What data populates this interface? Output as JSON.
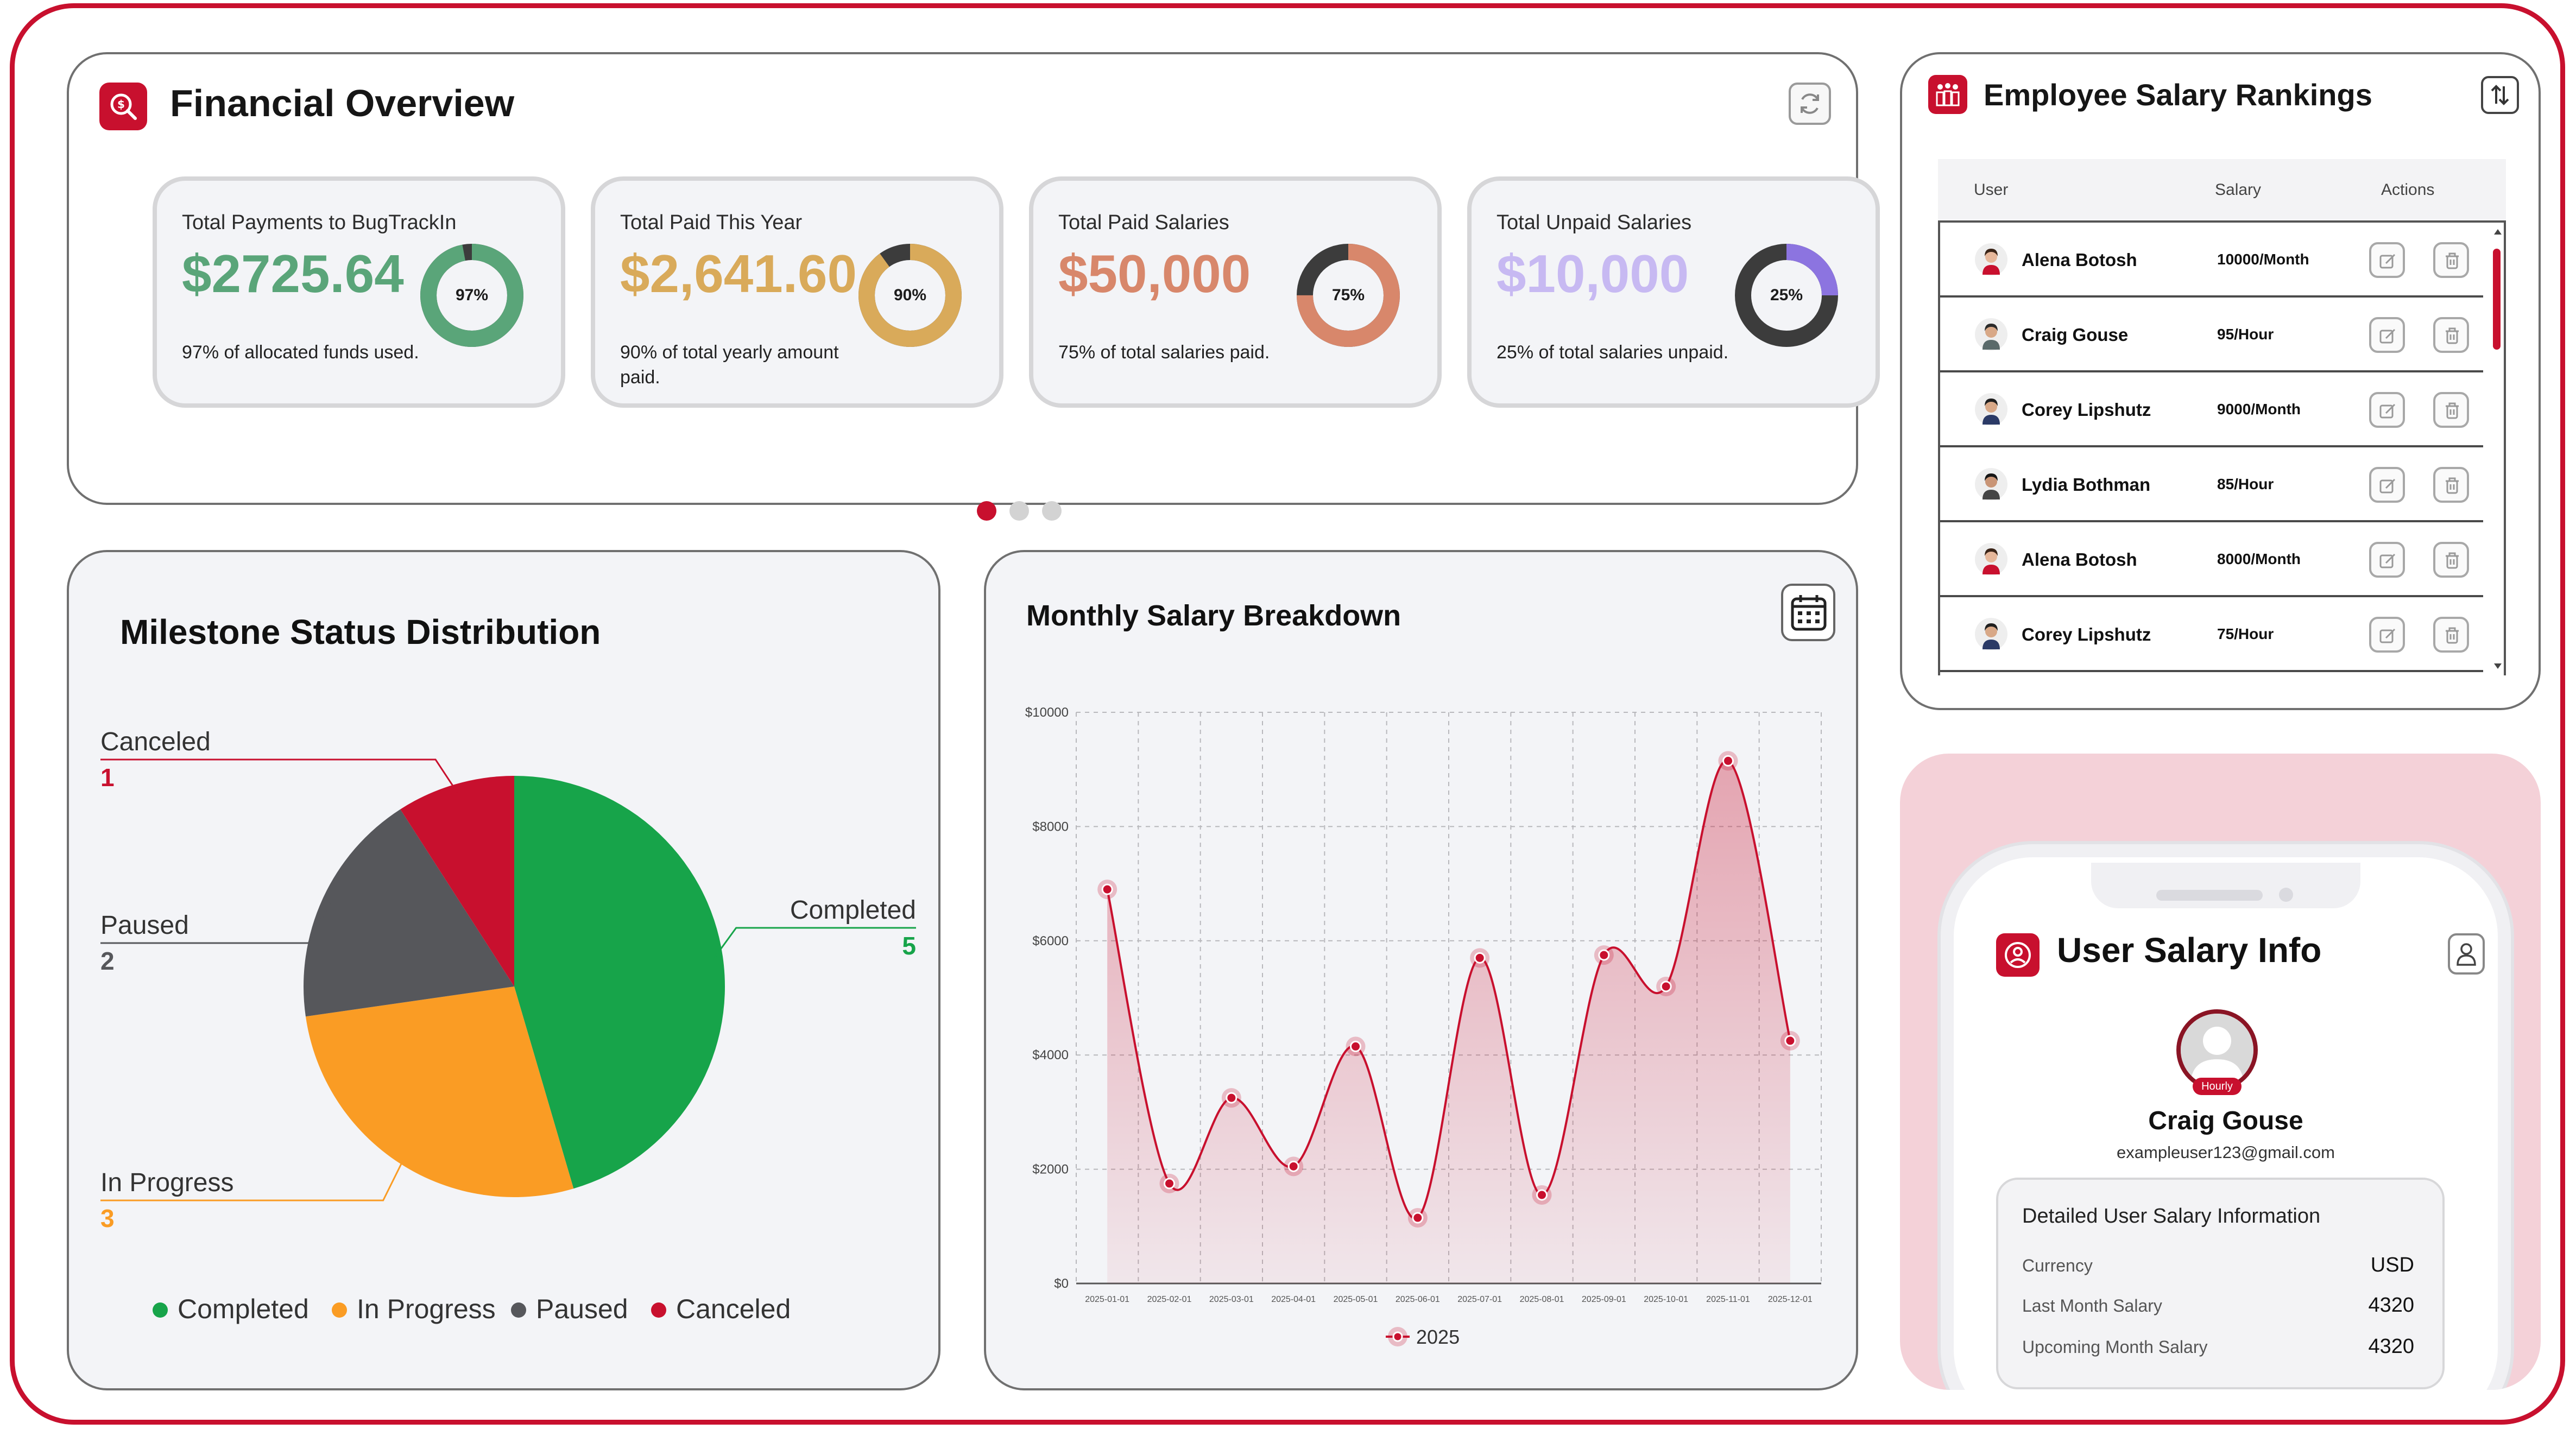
{
  "financial": {
    "title": "Financial Overview",
    "stats": [
      {
        "label": "Total Payments to BugTrackIn",
        "value": "$2725.64",
        "pct": 97,
        "pct_label": "97%",
        "note": "97% of allocated funds used.",
        "color": "#5aa579",
        "track": "#3c3c3c"
      },
      {
        "label": "Total Paid This Year",
        "value": "$2,641.60",
        "pct": 90,
        "pct_label": "90%",
        "note": "90% of total yearly amount paid.",
        "color": "#d9aa5a",
        "track": "#3c3c3c"
      },
      {
        "label": "Total Paid Salaries",
        "value": "$50,000",
        "pct": 75,
        "pct_label": "75%",
        "note": "75% of total salaries paid.",
        "color": "#d8876b",
        "track": "#3c3c3c"
      },
      {
        "label": "Total Unpaid Salaries",
        "value": "$10,000",
        "pct": 25,
        "pct_label": "25%",
        "note": "25% of total salaries unpaid.",
        "color": "#8c74e0",
        "track": "#3c3c3c",
        "value_color": "#c7b9f2"
      }
    ],
    "carousel_active": 0
  },
  "rankings": {
    "title": "Employee Salary Rankings",
    "columns": [
      "User",
      "Salary",
      "Actions"
    ],
    "rows": [
      {
        "name": "Alena Botosh",
        "salary": "10000/Month",
        "avatar": "female"
      },
      {
        "name": "Craig Gouse",
        "salary": "95/Hour",
        "avatar": "male-beard"
      },
      {
        "name": "Corey Lipshutz",
        "salary": "9000/Month",
        "avatar": "male-suit"
      },
      {
        "name": "Lydia Bothman",
        "salary": "85/Hour",
        "avatar": "female-dark"
      },
      {
        "name": "Alena Botosh",
        "salary": "8000/Month",
        "avatar": "female"
      },
      {
        "name": "Corey Lipshutz",
        "salary": "75/Hour",
        "avatar": "male-suit"
      }
    ]
  },
  "milestone": {
    "title": "Milestone Status Distribution",
    "legend": [
      "Completed",
      "In Progress",
      "Paused",
      "Canceled"
    ]
  },
  "monthly": {
    "title": "Monthly Salary Breakdown",
    "legend": "2025"
  },
  "userinfo": {
    "title": "User Salary Info",
    "badge": "Hourly",
    "name": "Craig Gouse",
    "email": "exampleuser123@gmail.com",
    "detail_title": "Detailed User Salary Information",
    "fields": [
      {
        "key": "Currency",
        "value": "USD"
      },
      {
        "key": "Last Month Salary",
        "value": "4320"
      },
      {
        "key": "Upcoming Month Salary",
        "value": "4320"
      }
    ]
  },
  "chart_data": [
    {
      "type": "pie",
      "categories": [
        "Completed",
        "In Progress",
        "Paused",
        "Canceled"
      ],
      "values": [
        5,
        3,
        2,
        1
      ],
      "colors": [
        "#17a44a",
        "#fa9c24",
        "#56575b",
        "#c8102e"
      ],
      "legend": "bottom"
    },
    {
      "type": "area",
      "x": [
        "2025-01-01",
        "2025-02-01",
        "2025-03-01",
        "2025-04-01",
        "2025-05-01",
        "2025-06-01",
        "2025-07-01",
        "2025-08-01",
        "2025-09-01",
        "2025-10-01",
        "2025-11-01",
        "2025-12-01"
      ],
      "series": [
        {
          "name": "2025",
          "values": [
            6900,
            1750,
            3250,
            2050,
            4150,
            1150,
            5700,
            1550,
            5750,
            5200,
            9150,
            4250
          ]
        }
      ],
      "ylim": [
        0,
        10000
      ],
      "yticks": [
        "$0",
        "$2000",
        "$4000",
        "$6000",
        "$8000",
        "$10000"
      ],
      "grid": true,
      "legend": "bottom",
      "color": "#c8102e"
    }
  ]
}
